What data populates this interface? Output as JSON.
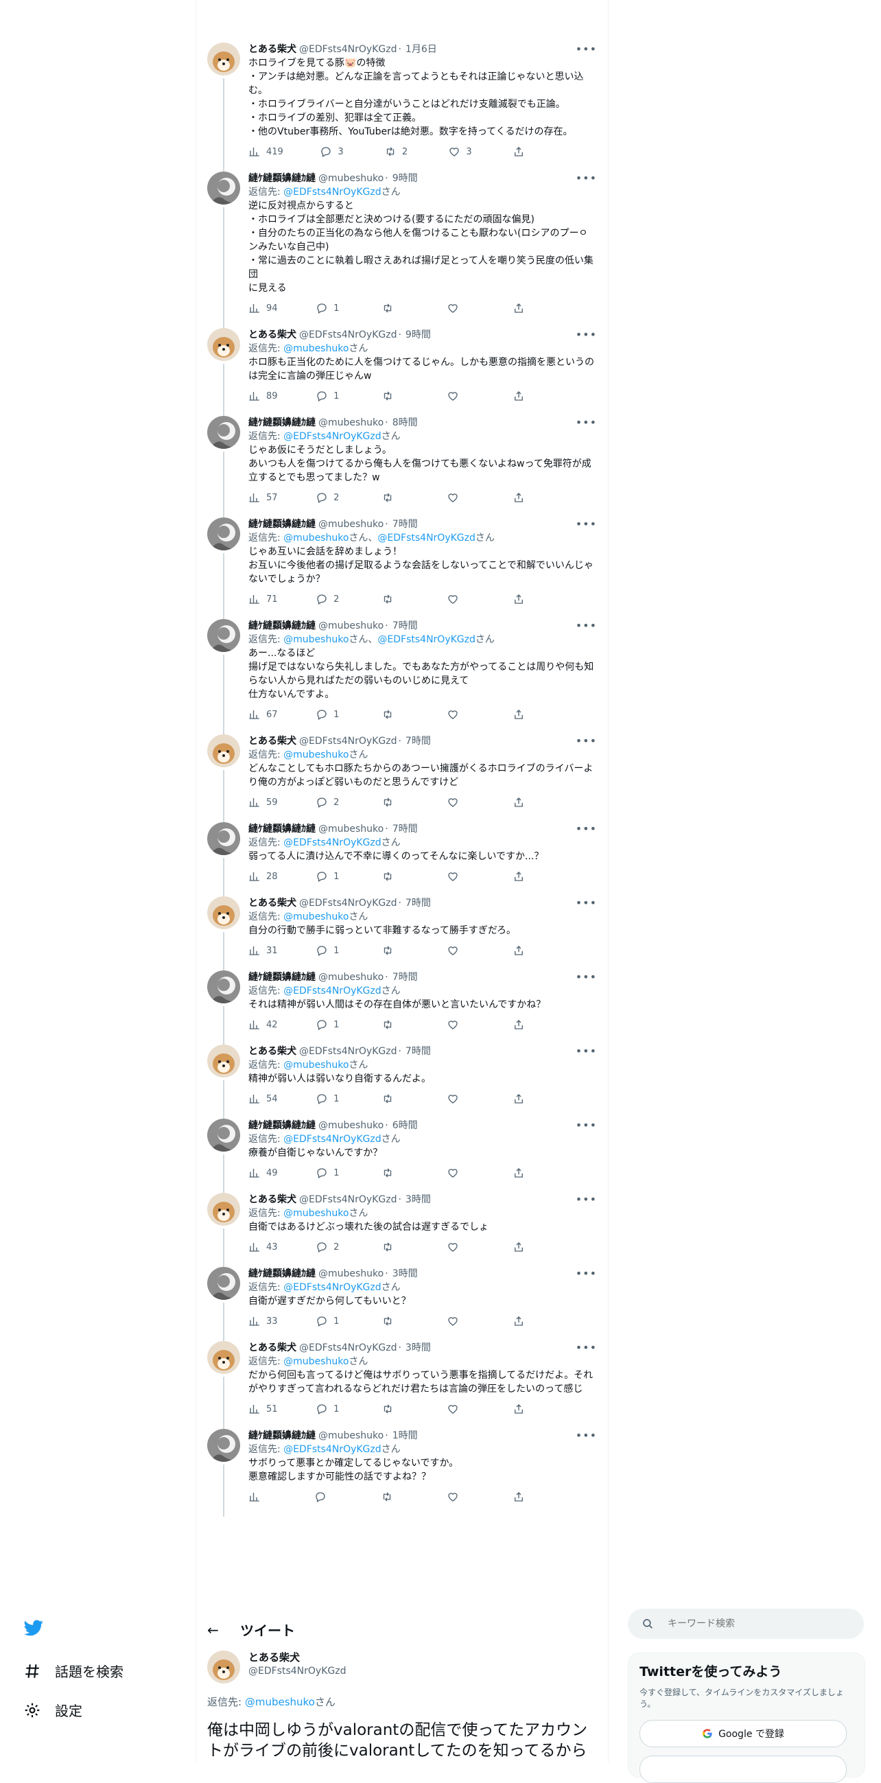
{
  "nav": {
    "items": [
      {
        "label": "話題を検索",
        "icon": "hashtag-icon"
      },
      {
        "label": "設定",
        "icon": "gear-icon"
      }
    ]
  },
  "users": {
    "shiba": {
      "name": "とある柴犬",
      "handle": "@EDFsts4NrOyKGzd"
    },
    "mube": {
      "name": "縺ｹ縺纇嬶縺ｶ縺",
      "handle": "@mubeshuko"
    }
  },
  "reply_prefix": "返信先: ",
  "reply_suffix": "さん",
  "reply_join": "さん、",
  "thread": [
    {
      "user": "shiba",
      "time": "1月6日",
      "reply_to": [],
      "text": "ホロライブを見てる豚🐷の特徴\n・アンチは絶対悪。どんな正論を言ってようともそれは正論じゃないと思い込む。\n・ホロライブライバーと自分達がいうことはどれだけ支離滅裂でも正論。\n・ホロライブの差別、犯罪は全て正義。\n・他のVtuber事務所、YouTuberは絶対悪。数字を持ってくるだけの存在。",
      "views": "419",
      "replies": "3",
      "retweets": "2",
      "likes": "3"
    },
    {
      "user": "mube",
      "time": "9時間",
      "reply_to": [
        "@EDFsts4NrOyKGzd"
      ],
      "text": "逆に反対視点からすると\n・ホロライブは全部悪だと決めつける(要するにただの頑固な偏見)\n・自分のたちの正当化の為なら他人を傷つけることも厭わない(ロシアのプーㅇンみたいな自己中)\n・常に過去のことに執着し暇さえあれば揚げ足とって人を嘲り笑う民度の低い集団\nに見える",
      "views": "94",
      "replies": "1",
      "retweets": "",
      "likes": ""
    },
    {
      "user": "shiba",
      "time": "9時間",
      "reply_to": [
        "@mubeshuko"
      ],
      "text": "ホロ豚も正当化のために人を傷つけてるじゃん。しかも悪意の指摘を悪というのは完全に言論の弾圧じゃんw",
      "views": "89",
      "replies": "1",
      "retweets": "",
      "likes": ""
    },
    {
      "user": "mube",
      "time": "8時間",
      "reply_to": [
        "@EDFsts4NrOyKGzd"
      ],
      "text": "じゃあ仮にそうだとしましょう。\nあいつも人を傷つけてるから俺も人を傷つけても悪くないよねwって免罪符が成立するとでも思ってました？w",
      "views": "57",
      "replies": "2",
      "retweets": "",
      "likes": ""
    },
    {
      "user": "mube",
      "time": "7時間",
      "reply_to": [
        "@mubeshuko",
        "@EDFsts4NrOyKGzd"
      ],
      "text": "じゃあ互いに会話を辞めましょう！\nお互いに今後他者の揚げ足取るような会話をしないってことで和解でいいんじゃないでしょうか？",
      "views": "71",
      "replies": "2",
      "retweets": "",
      "likes": ""
    },
    {
      "user": "mube",
      "time": "7時間",
      "reply_to": [
        "@mubeshuko",
        "@EDFsts4NrOyKGzd"
      ],
      "text": "あー...なるほど\n揚げ足ではないなら失礼しました。でもあなた方がやってることは周りや何も知らない人から見ればただの弱いものいじめに見えて\n仕方ないんですよ。",
      "views": "67",
      "replies": "1",
      "retweets": "",
      "likes": ""
    },
    {
      "user": "shiba",
      "time": "7時間",
      "reply_to": [
        "@mubeshuko"
      ],
      "text": "どんなことしてもホロ豚たちからのあつーい擁護がくるホロライブのライバーより俺の方がよっぽど弱いものだと思うんですけど",
      "views": "59",
      "replies": "2",
      "retweets": "",
      "likes": ""
    },
    {
      "user": "mube",
      "time": "7時間",
      "reply_to": [
        "@EDFsts4NrOyKGzd"
      ],
      "text": "弱ってる人に漬け込んで不幸に導くのってそんなに楽しいですか...？",
      "views": "28",
      "replies": "1",
      "retweets": "",
      "likes": ""
    },
    {
      "user": "shiba",
      "time": "7時間",
      "reply_to": [
        "@mubeshuko"
      ],
      "text": "自分の行動で勝手に弱っといて非難するなって勝手すぎだろ。",
      "views": "31",
      "replies": "1",
      "retweets": "",
      "likes": ""
    },
    {
      "user": "mube",
      "time": "7時間",
      "reply_to": [
        "@EDFsts4NrOyKGzd"
      ],
      "text": "それは精神が弱い人間はその存在自体が悪いと言いたいんですかね？",
      "views": "42",
      "replies": "1",
      "retweets": "",
      "likes": ""
    },
    {
      "user": "shiba",
      "time": "7時間",
      "reply_to": [
        "@mubeshuko"
      ],
      "text": "精神が弱い人は弱いなり自衛するんだよ。",
      "views": "54",
      "replies": "1",
      "retweets": "",
      "likes": ""
    },
    {
      "user": "mube",
      "time": "6時間",
      "reply_to": [
        "@EDFsts4NrOyKGzd"
      ],
      "text": "療養が自衛じゃないんですか？",
      "views": "49",
      "replies": "1",
      "retweets": "",
      "likes": ""
    },
    {
      "user": "shiba",
      "time": "3時間",
      "reply_to": [
        "@mubeshuko"
      ],
      "text": "自衛ではあるけどぶっ壊れた後の試合は遅すぎるでしょ",
      "views": "43",
      "replies": "2",
      "retweets": "",
      "likes": ""
    },
    {
      "user": "mube",
      "time": "3時間",
      "reply_to": [
        "@EDFsts4NrOyKGzd"
      ],
      "text": "自衛が遅すぎだから何してもいいと？",
      "views": "33",
      "replies": "1",
      "retweets": "",
      "likes": ""
    },
    {
      "user": "shiba",
      "time": "3時間",
      "reply_to": [
        "@mubeshuko"
      ],
      "text": "だから何回も言ってるけど俺はサボりっていう悪事を指摘してるだけだよ。それがやりすぎって言われるならどれだけ君たちは言論の弾圧をしたいのって感じ",
      "views": "51",
      "replies": "1",
      "retweets": "",
      "likes": ""
    },
    {
      "user": "mube",
      "time": "1時間",
      "reply_to": [
        "@EDFsts4NrOyKGzd"
      ],
      "text": "サボりって悪事とか確定してるじゃないですか。\n悪意確認しますか可能性の話ですよね？？",
      "views": "",
      "replies": "",
      "retweets": "",
      "likes": ""
    }
  ],
  "detail": {
    "title": "ツイート",
    "author_name": "とある柴犬",
    "author_handle": "@EDFsts4NrOyKGzd",
    "reply_prefix": "返信先: ",
    "reply_mention": "@mubeshuko",
    "reply_suffix": "さん",
    "text": "俺は中岡しゆうがvalorantの配信で使ってたアカウントがライブの前後にvalorantしてたのを知ってるからサボってる、って確認してるけど君にはその証拠がない"
  },
  "right": {
    "search_placeholder": "キーワード検索",
    "signup_title": "Twitterを使ってみよう",
    "signup_sub": "今すぐ登録して、タイムラインをカスタマイズしましょう。",
    "google_label": "Google で登録"
  },
  "colors": {
    "accent": "#1d9bf0",
    "text": "#0f1419",
    "muted": "#536471"
  }
}
